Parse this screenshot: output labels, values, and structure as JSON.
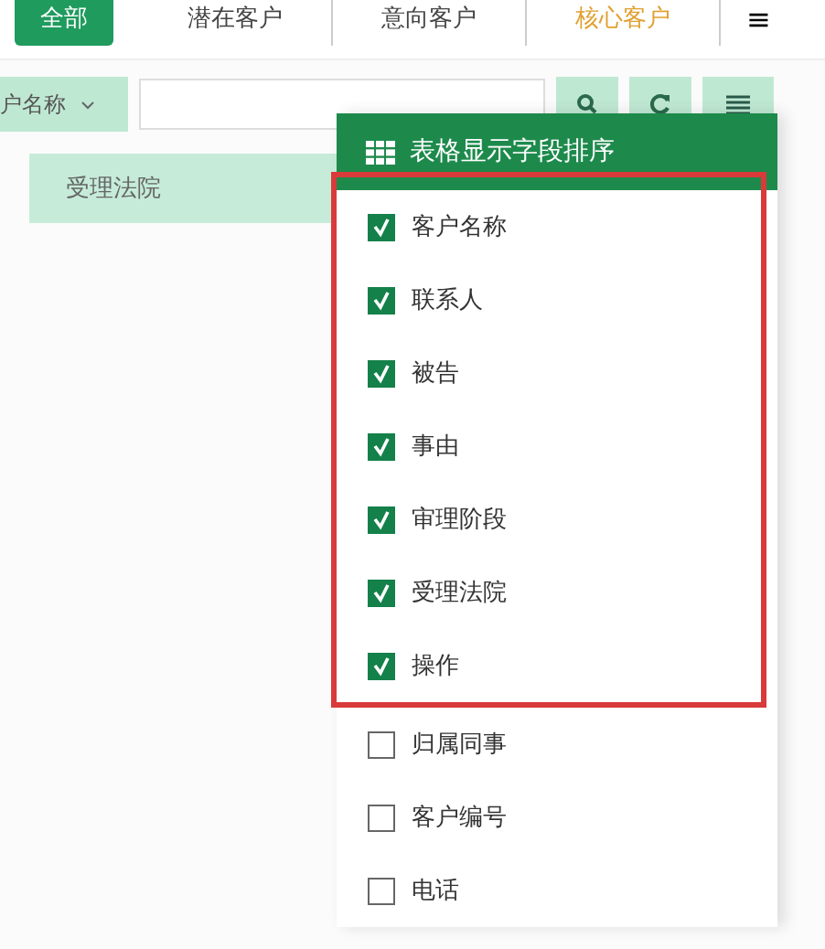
{
  "tabs": [
    {
      "label": "全部",
      "selected": true
    },
    {
      "label": "潜在客户",
      "selected": false,
      "color": "#444444"
    },
    {
      "label": "意向客户",
      "selected": false,
      "color": "#444444"
    },
    {
      "label": "核心客户",
      "selected": false,
      "color": "#e0a030"
    }
  ],
  "menu_button": "≡",
  "filter": {
    "field": "户名称"
  },
  "table": {
    "columns": [
      "受理法院"
    ]
  },
  "column_panel": {
    "title": "表格显示字段排序",
    "highlighted_items": [
      {
        "label": "客户名称",
        "checked": true
      },
      {
        "label": "联系人",
        "checked": true
      },
      {
        "label": "被告",
        "checked": true
      },
      {
        "label": "事由",
        "checked": true
      },
      {
        "label": "审理阶段",
        "checked": true
      },
      {
        "label": "受理法院",
        "checked": true
      },
      {
        "label": "操作",
        "checked": true
      }
    ],
    "items": [
      {
        "label": "归属同事",
        "checked": false
      },
      {
        "label": "客户编号",
        "checked": false
      },
      {
        "label": "电话",
        "checked": false
      }
    ]
  }
}
